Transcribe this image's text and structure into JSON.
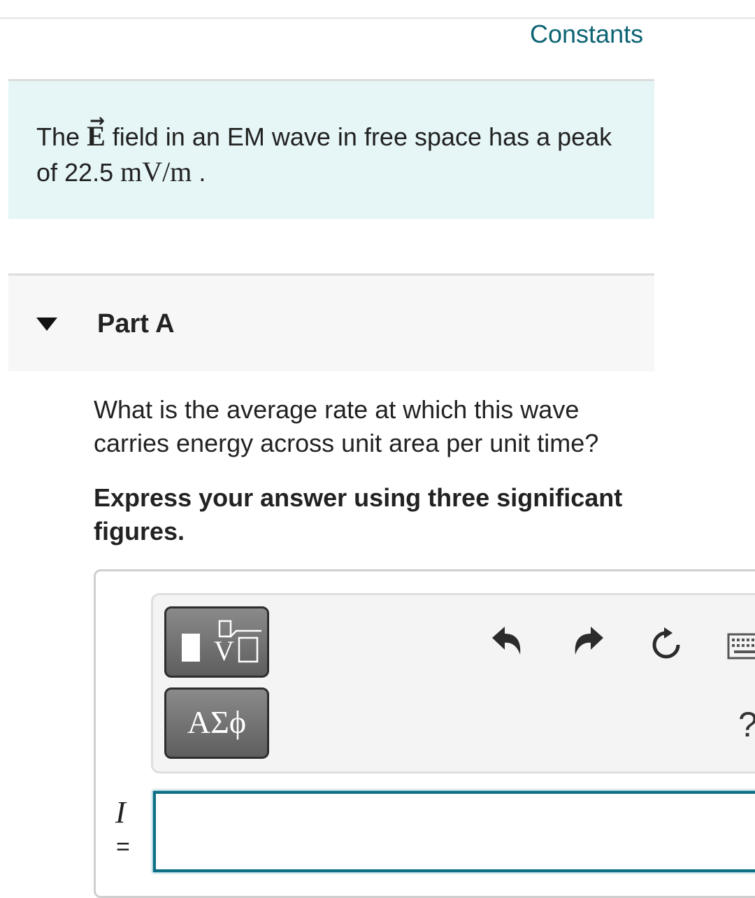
{
  "header": {
    "constants_link": "Constants"
  },
  "intro": {
    "text_before": "The",
    "vector_symbol": "E",
    "text_after": "field in an EM wave in free space has a peak of 22.5",
    "unit": "mV/m",
    "period": "."
  },
  "part": {
    "title": "Part A",
    "question": "What is the average rate at which this wave carries energy across unit area per unit time?",
    "instruction": "Express your answer using three significant figures."
  },
  "toolbar": {
    "greek_label": "ΑΣϕ",
    "icons": [
      "templates-icon",
      "undo-icon",
      "redo-icon",
      "reset-icon",
      "keyboard-icon",
      "help-icon"
    ],
    "help_label": "?"
  },
  "answer": {
    "variable": "I",
    "equals": "=",
    "value": ""
  },
  "colors": {
    "link": "#0c6373",
    "intro_bg": "#e6f5f6",
    "input_border": "#0e6f84"
  }
}
